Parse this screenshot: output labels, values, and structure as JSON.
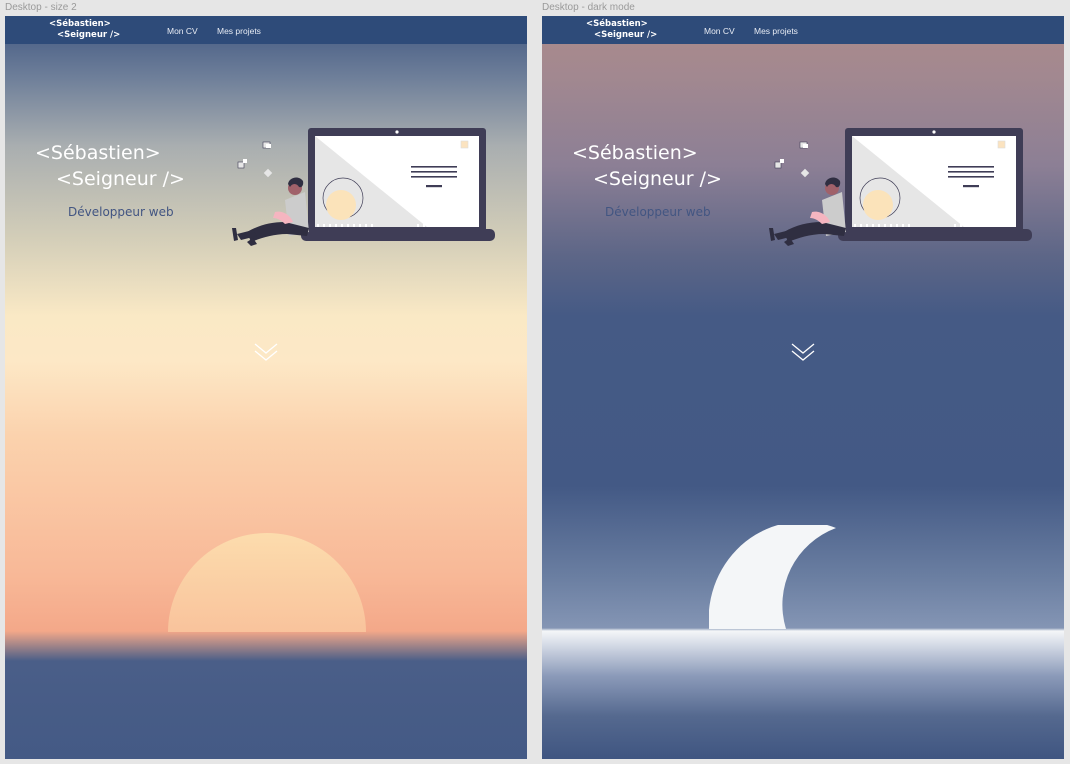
{
  "canvas": {
    "frames": [
      {
        "label": "Desktop - size 2",
        "nav": {
          "logo_line1": "<Sébastien>",
          "logo_line2": "<Seigneur />",
          "links": [
            "Mon CV",
            "Mes projets"
          ]
        },
        "hero": {
          "title_line1": "<Sébastien>",
          "title_line2": "<Seigneur  />",
          "subtitle": "Développeur web"
        },
        "scroll_icon": "double-chevron-down-icon",
        "horizon_object": "sun-icon"
      },
      {
        "label": "Desktop - dark mode",
        "nav": {
          "logo_line1": "<Sébastien>",
          "logo_line2": "<Seigneur />",
          "links": [
            "Mon CV",
            "Mes projets"
          ]
        },
        "hero": {
          "title_line1": "<Sébastien>",
          "title_line2": "<Seigneur />",
          "subtitle": "Développeur web"
        },
        "scroll_icon": "double-chevron-down-icon",
        "horizon_object": "moon-icon"
      }
    ]
  },
  "colors": {
    "nav": "#2e4b79",
    "subtitle": "#425582",
    "laptop": "#3f3d56",
    "sun": "#fbd3a5",
    "moon": "#f4f6f8"
  }
}
